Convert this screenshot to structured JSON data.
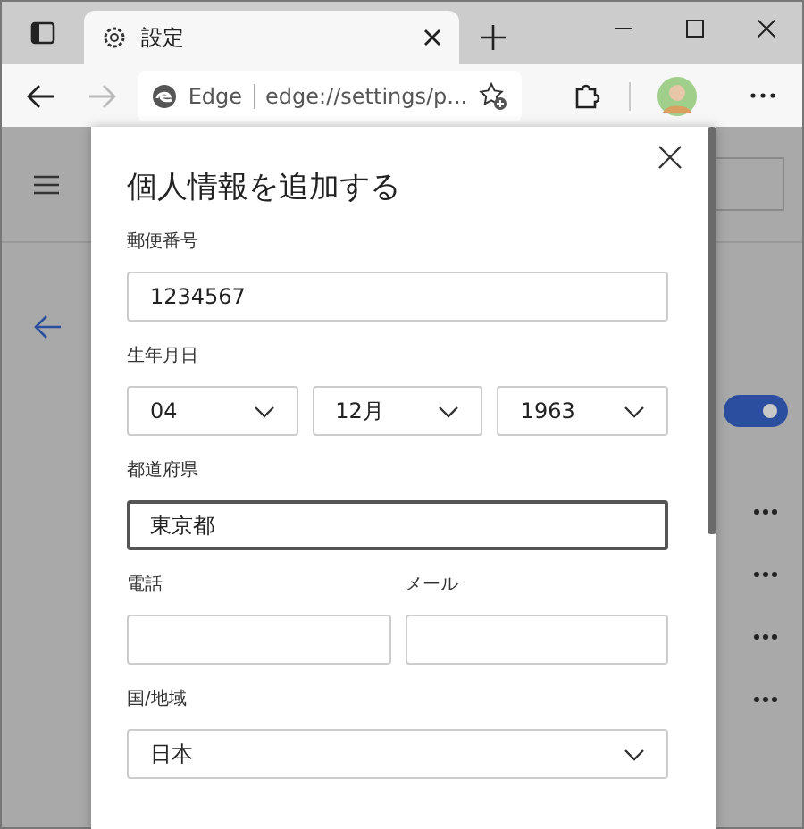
{
  "browser": {
    "tab": {
      "title": "設定"
    },
    "address": {
      "site": "Edge",
      "url": "edge://settings/p..."
    }
  },
  "page": {
    "toggle": {
      "on": true
    }
  },
  "dialog": {
    "title": "個人情報を追加する",
    "rows": [
      {
        "fields": [
          {
            "label": "郵便番号",
            "kind": "text",
            "value": "1234567",
            "focused": false
          }
        ]
      },
      {
        "label": "生年月日",
        "fields": [
          {
            "kind": "select",
            "value": "04",
            "focused": false
          },
          {
            "kind": "select",
            "value": "12月",
            "focused": false
          },
          {
            "kind": "select",
            "value": "1963",
            "focused": false
          }
        ]
      },
      {
        "fields": [
          {
            "label": "都道府県",
            "kind": "text",
            "value": "東京都",
            "focused": true
          }
        ]
      },
      {
        "fields": [
          {
            "label": "電話",
            "kind": "text",
            "focused": false
          },
          {
            "label": "メール",
            "kind": "text",
            "focused": false
          }
        ]
      },
      {
        "fields": [
          {
            "label": "国/地域",
            "kind": "select",
            "value": "日本",
            "focused": false
          }
        ]
      }
    ]
  }
}
